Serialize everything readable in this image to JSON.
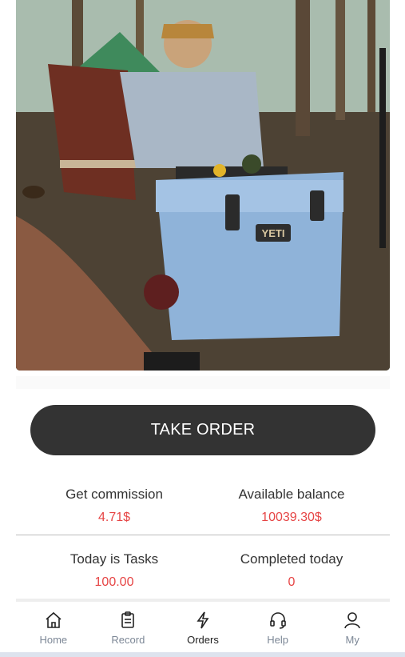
{
  "hero": {
    "brand_text": "YETI"
  },
  "action": {
    "take_order_label": "TAKE ORDER"
  },
  "stats": {
    "get_commission": {
      "label": "Get commission",
      "value": "4.71$"
    },
    "available_balance": {
      "label": "Available balance",
      "value": "10039.30$"
    },
    "today_tasks": {
      "label": "Today is Tasks",
      "value": "100.00"
    },
    "completed_today": {
      "label": "Completed today",
      "value": "0"
    }
  },
  "nav": {
    "items": [
      {
        "label": "Home",
        "icon": "home-icon"
      },
      {
        "label": "Record",
        "icon": "clipboard-icon"
      },
      {
        "label": "Orders",
        "icon": "lightning-icon",
        "active": true
      },
      {
        "label": "Help",
        "icon": "headset-icon"
      },
      {
        "label": "My",
        "icon": "user-icon"
      }
    ]
  },
  "colors": {
    "button_bg": "#333333",
    "value_red": "#e64545",
    "nav_inactive": "#7c8796"
  }
}
